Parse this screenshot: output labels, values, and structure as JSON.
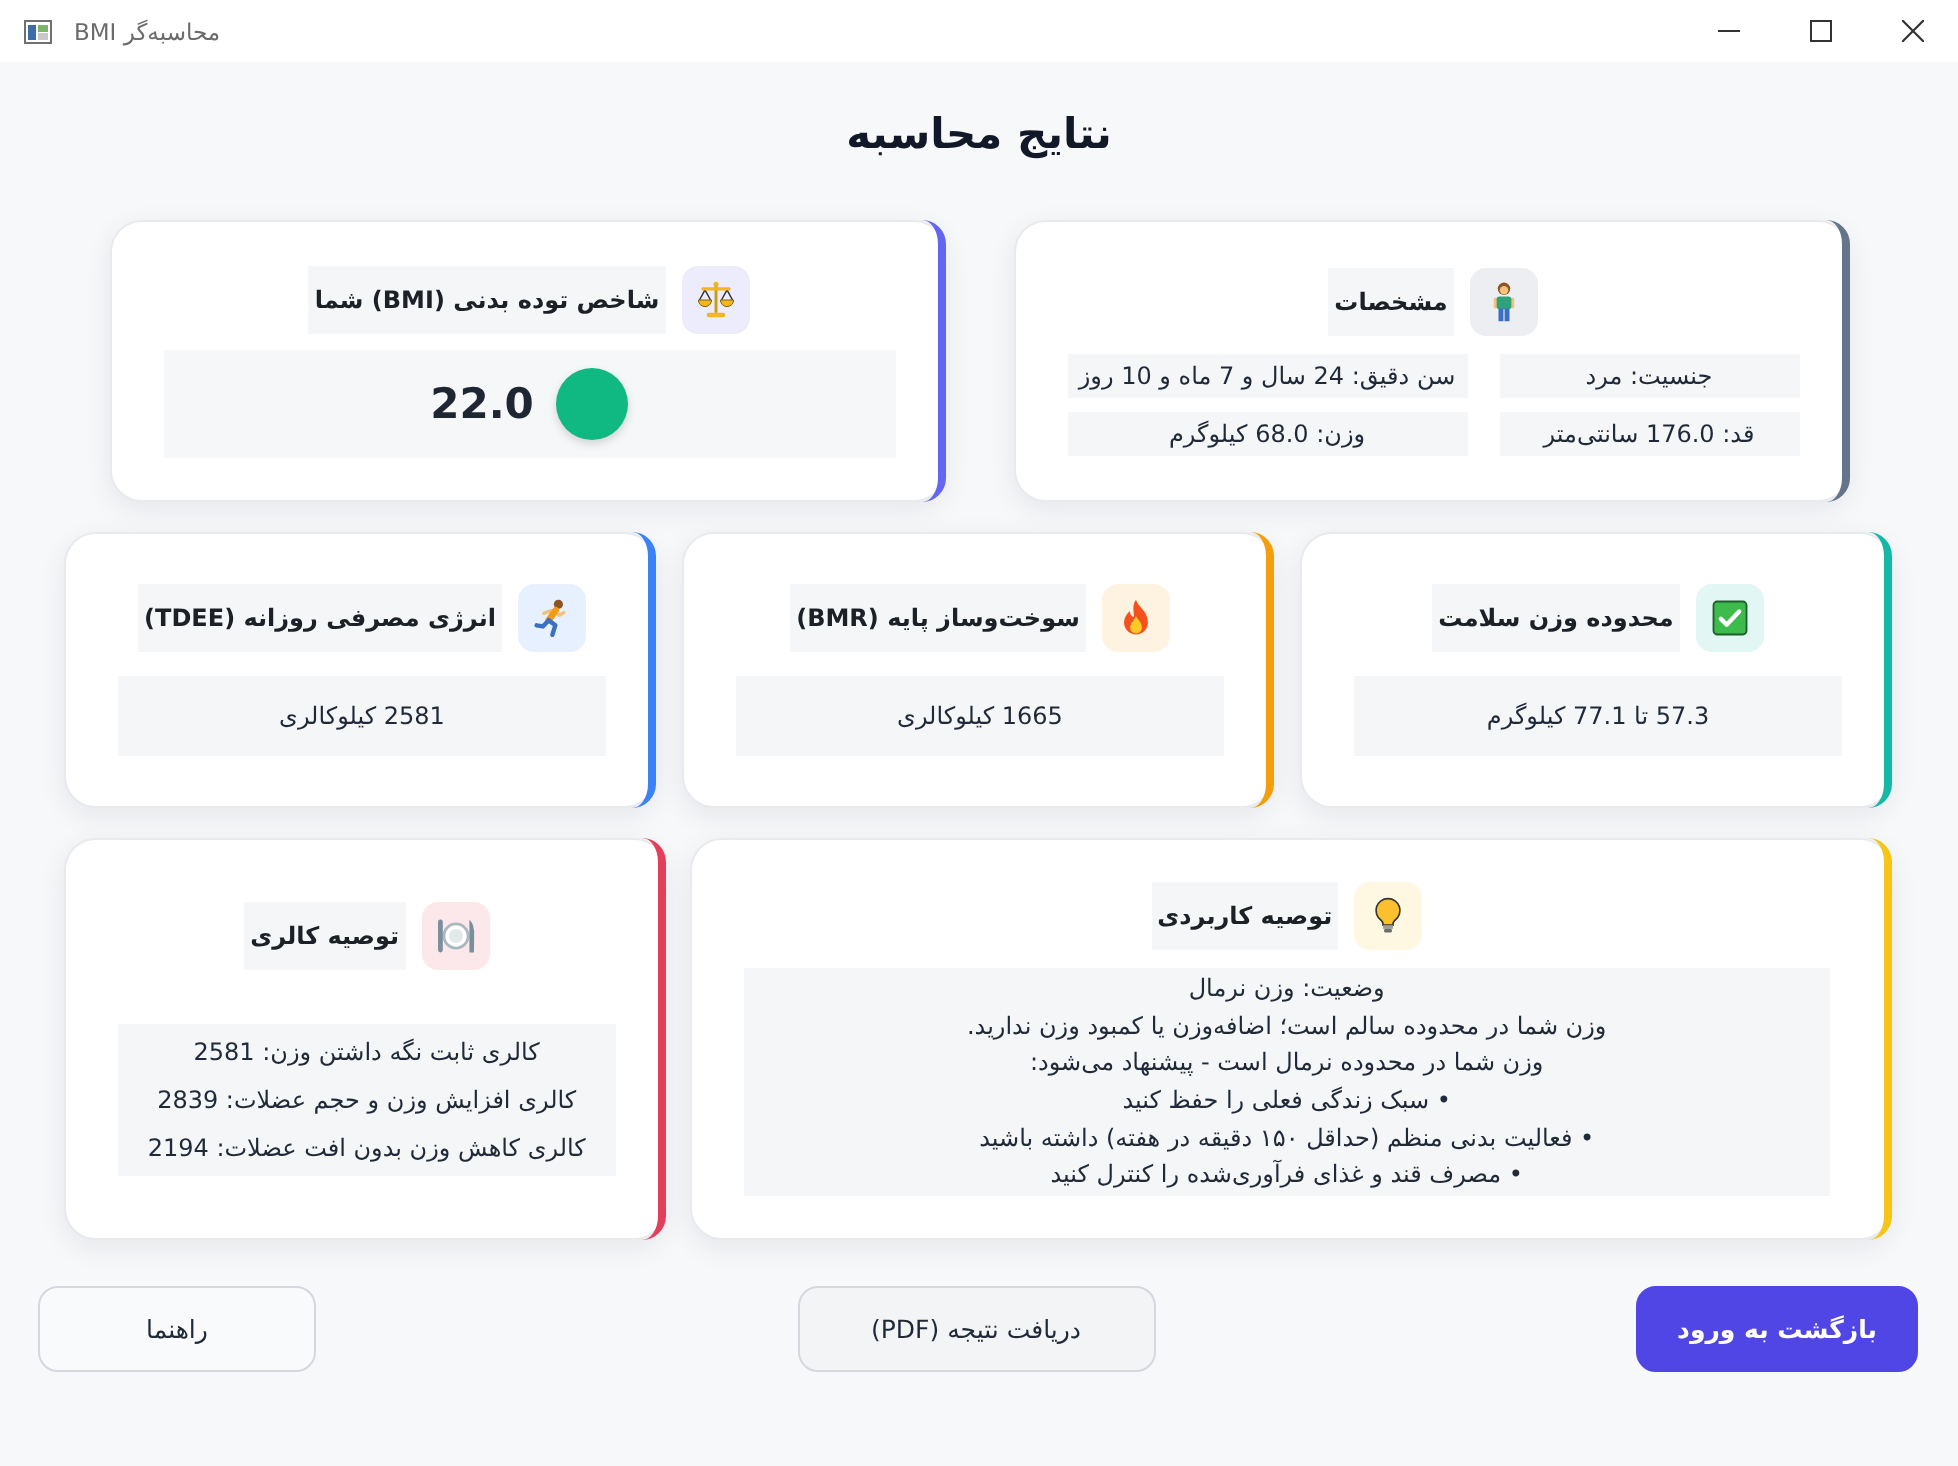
{
  "window": {
    "title": "محاسبه‌گر BMI"
  },
  "heading": "نتایج محاسبه",
  "rows": [
    {
      "cards": [
        {
          "kind": "details",
          "title": "مشخصات",
          "color": "#64748b",
          "fields": [
            "جنسیت: مرد",
            "سن دقیق: 24 سال و 7 ماه و 10 روز",
            "قد: 176.0 سانتی‌متر",
            "وزن: 68.0 کیلوگرم"
          ]
        },
        {
          "kind": "bmi",
          "title": "شاخص توده بدنی (BMI) شما",
          "color": "#6366f1",
          "value": "22.0",
          "dot": {
            "color": "#10b981"
          }
        }
      ]
    },
    {
      "cards": [
        {
          "kind": "value",
          "title": "محدوده وزن سلامت",
          "color": "#14b8a6",
          "value": "57.3 تا 77.1 کیلوگرم"
        },
        {
          "kind": "value",
          "title": "سوخت‌وساز پایه (BMR)",
          "color": "#f59e0b",
          "value": "1665 کیلوکالری"
        },
        {
          "kind": "value",
          "title": "انرژی مصرفی روزانه (TDEE)",
          "color": "#3b82f6",
          "value": "2581 کیلوکالری"
        }
      ]
    },
    {
      "cards": [
        {
          "kind": "advice",
          "title": "توصیه کاربردی",
          "color": "#f5c518",
          "lines": [
            "وضعیت: وزن نرمال",
            "وزن شما در محدوده سالم است؛ اضافه‌وزن یا کمبود وزن ندارید.",
            "وزن شما در محدوده نرمال است - پیشنهاد می‌شود:",
            "• سبک زندگی فعلی را حفظ کنید",
            "• فعالیت بدنی منظم (حداقل ۱۵۰ دقیقه در هفته) داشته باشید",
            "• مصرف قند و غذای فرآوری‌شده را کنترل کنید"
          ]
        },
        {
          "kind": "list",
          "title": "توصیه کالری",
          "color": "#e43f5a",
          "lines": [
            "کالری ثابت نگه داشتن وزن: 2581",
            "کالری افزایش وزن و حجم عضلات: 2839",
            "کالری کاهش وزن بدون افت عضلات: 2194"
          ]
        }
      ]
    }
  ],
  "buttons": [
    {
      "label": "بازگشت به ورود",
      "kind": "primary"
    },
    {
      "label": "دریافت نتیجه (PDF)",
      "kind": "secondary"
    },
    {
      "label": "راهنما",
      "kind": "plain"
    }
  ]
}
